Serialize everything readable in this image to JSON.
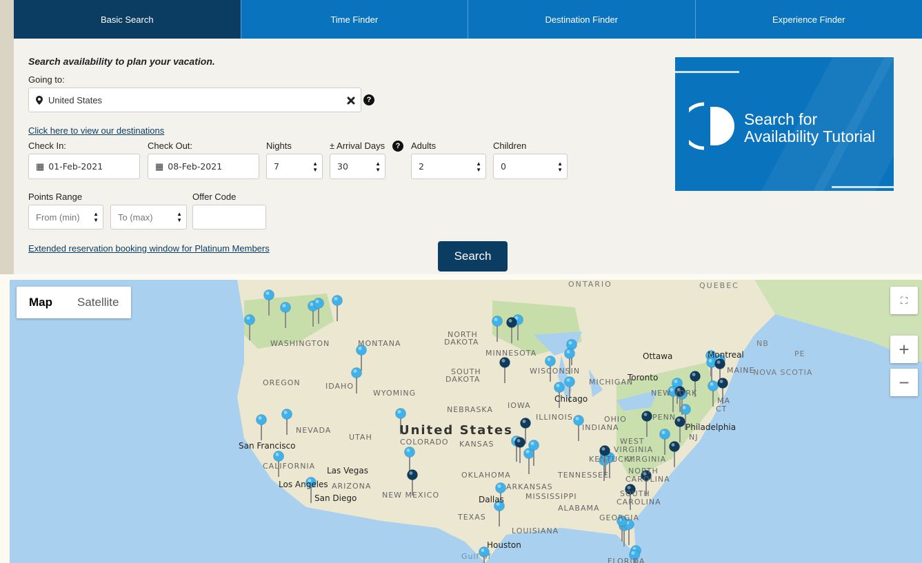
{
  "tabs": [
    {
      "label": "Basic Search",
      "active": true
    },
    {
      "label": "Time Finder",
      "active": false
    },
    {
      "label": "Destination Finder",
      "active": false
    },
    {
      "label": "Experience Finder",
      "active": false
    }
  ],
  "form": {
    "intro": "Search availability to plan your vacation.",
    "going_to_label": "Going to:",
    "going_to_value": "United States",
    "view_destinations_link": "Click here to view our destinations",
    "check_in_label": "Check In:",
    "check_in_value": "01-Feb-2021",
    "check_out_label": "Check Out:",
    "check_out_value": "08-Feb-2021",
    "nights_label": "Nights",
    "nights_value": "7",
    "arrival_days_label": "± Arrival Days",
    "arrival_days_value": "30",
    "adults_label": "Adults",
    "adults_value": "2",
    "children_label": "Children",
    "children_value": "0",
    "points_range_label": "Points Range",
    "points_from_placeholder": "From (min)",
    "points_to_placeholder": "To (max)",
    "offer_code_label": "Offer Code",
    "offer_code_value": "",
    "extended_link": "Extended reservation booking window for Platinum Members",
    "search_button": "Search"
  },
  "banner": {
    "line1": "Search for",
    "line2": "Availability Tutorial"
  },
  "map": {
    "type_map": "Map",
    "type_satellite": "Satellite",
    "zoom_in": "+",
    "zoom_out": "−",
    "labels": {
      "ontario": "ONTARIO",
      "quebec": "QUEBEC",
      "washington": "WASHINGTON",
      "montana": "MONTANA",
      "north_dakota_1": "NORTH",
      "north_dakota_2": "DAKOTA",
      "minnesota": "MINNESOTA",
      "south_dakota_1": "SOUTH",
      "south_dakota_2": "DAKOTA",
      "wisconsin": "WISCONSIN",
      "michigan": "MICHIGAN",
      "oregon": "OREGON",
      "idaho": "IDAHO",
      "wyoming": "WYOMING",
      "iowa": "IOWA",
      "nebraska": "NEBRASKA",
      "chicago": "Chicago",
      "illinois": "ILLINOIS",
      "nevada": "NEVADA",
      "utah": "UTAH",
      "united_states": "United States",
      "colorado": "COLORADO",
      "kansas": "KANSAS",
      "indiana": "INDIANA",
      "ohio": "OHIO",
      "san_francisco": "San Francisco",
      "california": "CALIFORNIA",
      "las_vegas": "Las Vegas",
      "los_angeles": "Los Angeles",
      "san_diego": "San Diego",
      "arizona": "ARIZONA",
      "new_mexico": "NEW MEXICO",
      "oklahoma": "OKLAHOMA",
      "arkansas": "ARKANSAS",
      "dallas": "Dallas",
      "texas": "TEXAS",
      "mississippi": "MISSISSIPPI",
      "alabama": "ALABAMA",
      "louisiana": "LOUISIANA",
      "houston": "Houston",
      "tennessee": "TENNESSEE",
      "kentucky": "KENTUCKY",
      "west_virginia_1": "WEST",
      "west_virginia_2": "VIRGINIA",
      "virginia": "VIRGINIA",
      "north_carolina_1": "NORTH",
      "north_carolina_2": "CAROLINA",
      "south_carolina_1": "SOUTH",
      "south_carolina_2": "CAROLINA",
      "georgia": "GEORGIA",
      "florida": "FLORIDA",
      "ottawa": "Ottawa",
      "montreal": "Montreal",
      "toronto": "Toronto",
      "new_york": "NEW YORK",
      "philadelphia": "Philadelphia",
      "penn": "PENN",
      "nj": "NJ",
      "maine": "MAINE",
      "ma": "MA",
      "ct": "CT",
      "nb": "NB",
      "pe": "PE",
      "nova_scotia": "NOVA SCOTIA",
      "gulf": "Gulf of"
    },
    "colors": {
      "water": "#a9d0ee",
      "land": "#eae6cf",
      "forest": "#c6dfa8",
      "pin_light": "#3fb2ec",
      "pin_dark": "#0e3a5c"
    }
  }
}
